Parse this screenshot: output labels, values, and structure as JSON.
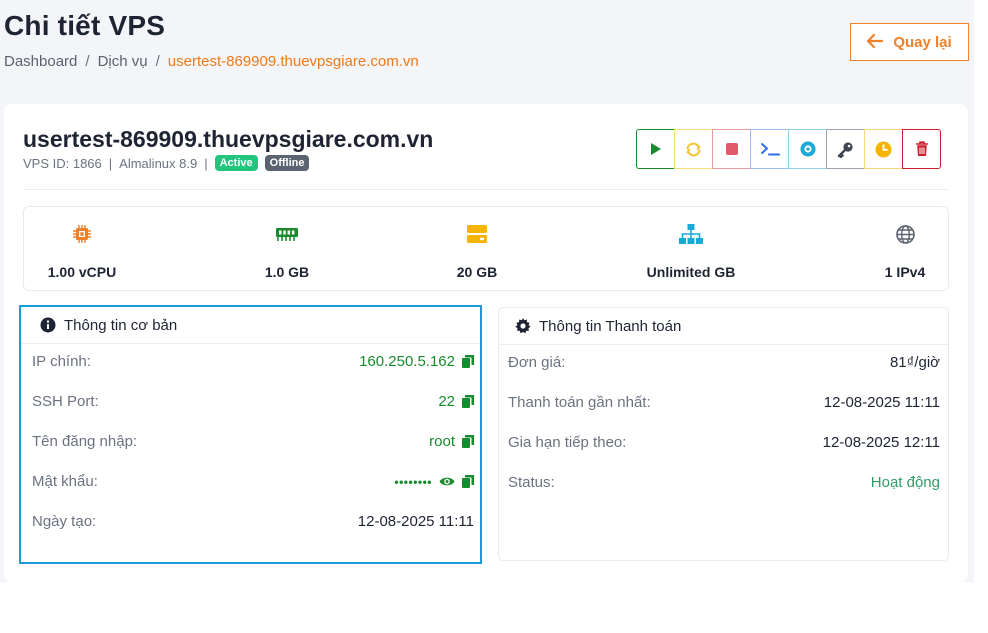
{
  "header": {
    "title": "Chi tiết VPS",
    "breadcrumb": [
      "Dashboard",
      "Dịch vụ",
      "usertest-869909.thuevpsgiare.com.vn"
    ],
    "breadcrumb_sep": "/",
    "back_label": "Quay lại"
  },
  "vps": {
    "hostname": "usertest-869909.thuevpsgiare.com.vn",
    "vps_id": "VPS ID: 1866",
    "os": "Almalinux 8.9",
    "sep": "|",
    "badges": [
      "Active",
      "Offline"
    ]
  },
  "actions": [
    {
      "name": "start",
      "icon": "play-icon",
      "color": "#1a8a2e"
    },
    {
      "name": "restart",
      "icon": "refresh-icon",
      "color": "#f2c230"
    },
    {
      "name": "stop",
      "icon": "stop-icon",
      "color": "#e15a6a"
    },
    {
      "name": "console",
      "icon": "terminal-icon",
      "color": "#2d6ee0"
    },
    {
      "name": "reinstall",
      "icon": "disc-icon",
      "color": "#18a9d6"
    },
    {
      "name": "password",
      "icon": "key-icon",
      "color": "#3f4654"
    },
    {
      "name": "schedule",
      "icon": "clock-icon",
      "color": "#f5b400"
    },
    {
      "name": "delete",
      "icon": "trash-icon",
      "color": "#c8202f"
    }
  ],
  "specs": [
    {
      "icon": "cpu-icon",
      "value": "1.00 vCPU",
      "color": "#f0812a"
    },
    {
      "icon": "ram-icon",
      "value": "1.0 GB",
      "color": "#1a8a2e"
    },
    {
      "icon": "storage-icon",
      "value": "20 GB",
      "color": "#f5b400"
    },
    {
      "icon": "network-icon",
      "value": "Unlimited GB",
      "color": "#18a9d6"
    },
    {
      "icon": "globe-icon",
      "value": "1 IPv4",
      "color": "#5b6270"
    }
  ],
  "basic_info": {
    "title": "Thông tin cơ bản",
    "rows": [
      {
        "label": "IP chính:",
        "value": "160.250.5.162"
      },
      {
        "label": "SSH Port:",
        "value": "22"
      },
      {
        "label": "Tên đăng nhập:",
        "value": "root"
      },
      {
        "label": "Mật khẩu:",
        "value": "••••••••"
      },
      {
        "label": "Ngày tạo:",
        "value": "12-08-2025 11:11"
      }
    ]
  },
  "payment_info": {
    "title": "Thông tin Thanh toán",
    "rows": [
      {
        "label": "Đơn giá:",
        "value": "81₫/giờ"
      },
      {
        "label": "Thanh toán gần nhất:",
        "value": "12-08-2025 11:11"
      },
      {
        "label": "Gia hạn tiếp theo:",
        "value": "12-08-2025 12:11"
      },
      {
        "label": "Status:",
        "value": "Hoạt động"
      }
    ]
  },
  "colors": {
    "accent": "#f0812a",
    "highlight_border": "#1a9ad6",
    "value_green": "#1a8a2e"
  }
}
